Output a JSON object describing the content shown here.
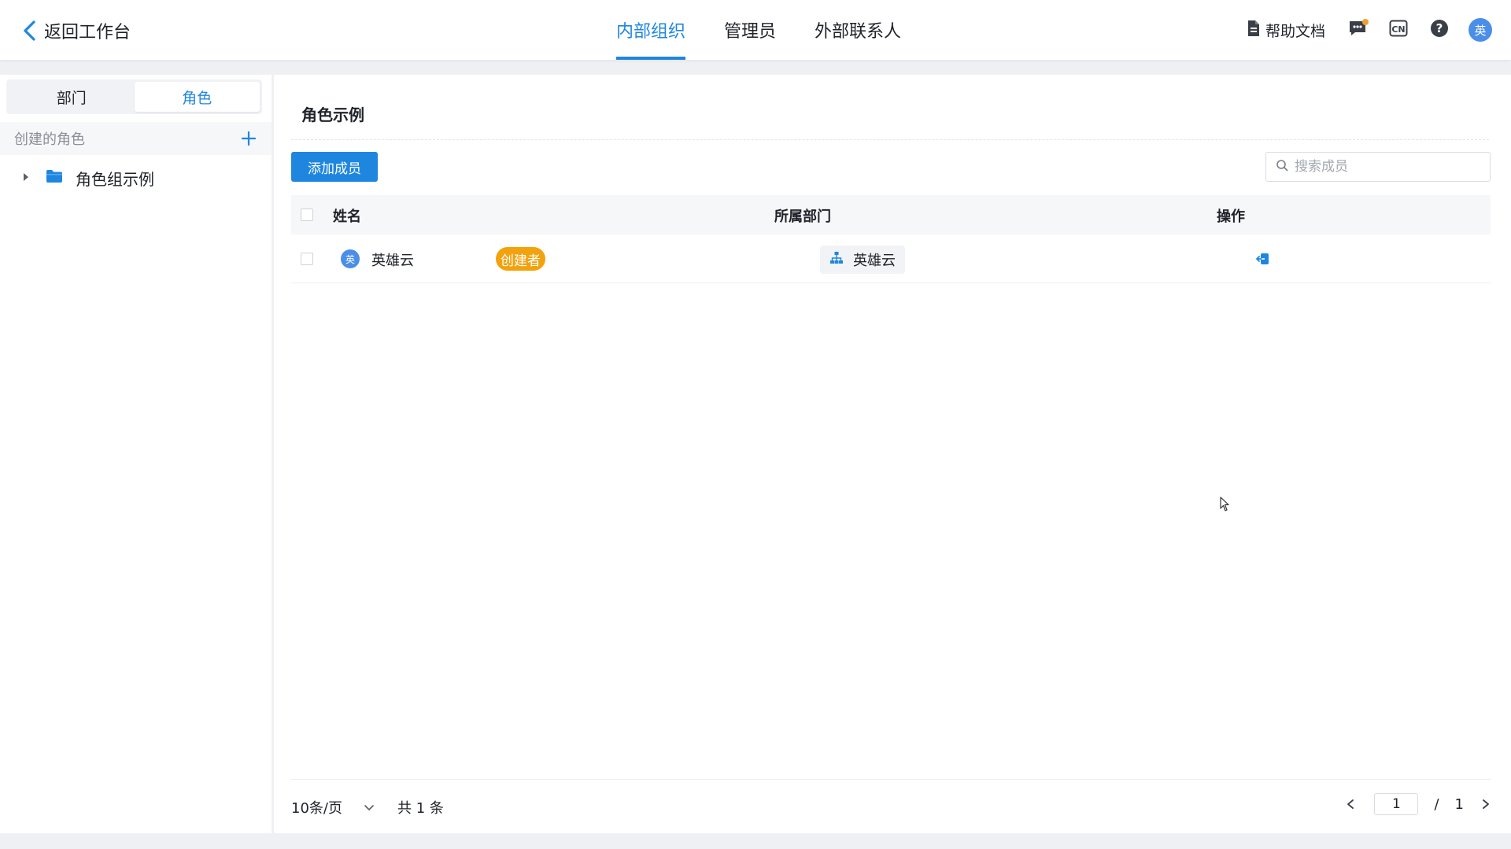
{
  "topbar": {
    "back_label": "返回工作台",
    "tabs": [
      {
        "label": "内部组织",
        "active": true
      },
      {
        "label": "管理员",
        "active": false
      },
      {
        "label": "外部联系人",
        "active": false
      }
    ],
    "help_doc_label": "帮助文档",
    "lang_icon_text": "CN",
    "avatar_text": "英",
    "accent_color": "#1f86e0"
  },
  "sidebar": {
    "segments": [
      {
        "label": "部门",
        "active": false
      },
      {
        "label": "角色",
        "active": true
      }
    ],
    "created_roles_label": "创建的角色",
    "tree": [
      {
        "label": "角色组示例",
        "expanded": false,
        "icon": "folder-icon"
      }
    ]
  },
  "main": {
    "title": "角色示例",
    "add_button_label": "添加成员",
    "search_placeholder": "搜索成员",
    "columns": {
      "name": "姓名",
      "department": "所属部门",
      "actions": "操作"
    },
    "rows": [
      {
        "avatar_text": "英",
        "name": "英雄云",
        "badge": "创建者",
        "badge_color": "#f2a20c",
        "department": "英雄云"
      }
    ],
    "footer": {
      "page_size": "10条/页",
      "total": "共 1 条",
      "current_page": "1",
      "separator": "/",
      "total_pages": "1"
    }
  }
}
